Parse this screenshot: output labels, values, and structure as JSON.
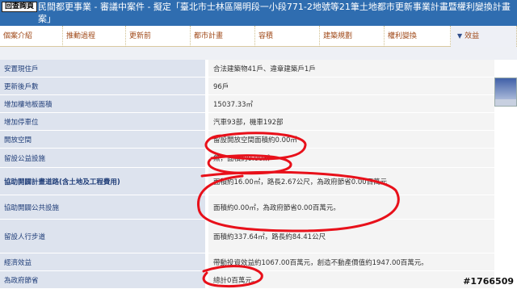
{
  "header": {
    "back_label": "回查詢頁",
    "title": "民間都更事業 - 審議中案件 - 擬定「臺北市士林區陽明段一小段771-2地號等21筆土地都市更新事業計畫暨權利變換計畫案」"
  },
  "tabs": [
    {
      "label": "個案介紹"
    },
    {
      "label": "推動過程"
    },
    {
      "label": "更新前"
    },
    {
      "label": "都市計畫"
    },
    {
      "label": "容積"
    },
    {
      "label": "建築規劃"
    },
    {
      "label": "權利變換"
    },
    {
      "label": "效益",
      "active": true
    }
  ],
  "rows": [
    {
      "label": "安置現住戶",
      "value": "合法建築物41戶、違章建築戶1戶"
    },
    {
      "label": "更新後戶數",
      "value": "96戶"
    },
    {
      "label": "增加樓地板面積",
      "value": "15037.33㎡"
    },
    {
      "label": "增加停車位",
      "value": "汽車93部，機車192部"
    },
    {
      "label": "開放空間",
      "value": "留設開放空間面積約0.00㎡"
    },
    {
      "label": "留設公益設施",
      "value": "無，面積約0.00㎡"
    },
    {
      "label": "協助開闢計畫道路(含土地及工程費用)",
      "value": "面積約16.00㎡，路長2.67公尺，為政府節省0.00百萬元"
    },
    {
      "label": "協助開闢公共設施",
      "value": "面積約0.00㎡，為政府節省0.00百萬元。"
    },
    {
      "label": "留設人行步道",
      "value": "面積約337.64㎡，路長約84.41公尺"
    },
    {
      "label": "經濟效益",
      "value": "帶動投資效益約1067.00百萬元，創造不動產價值約1947.00百萬元。"
    },
    {
      "label": "為政府節省",
      "value": "總計0百萬元。"
    }
  ],
  "watermark": "#1766509",
  "colors": {
    "header": "#2f6db0",
    "label_bg": "#dde3ee",
    "value_bg": "#f4f4f4",
    "tab_text": "#a04a1a",
    "annotation": "#e8101a"
  }
}
